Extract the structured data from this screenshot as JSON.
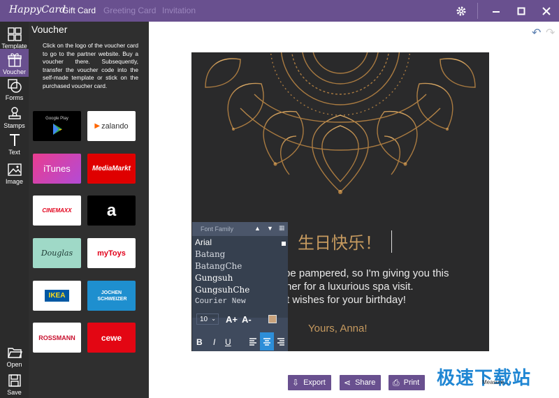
{
  "app": {
    "logo": "HappyCard",
    "tabs": [
      "Gift Card",
      "Greeting Card",
      "Invitation"
    ]
  },
  "rail": {
    "items": [
      {
        "label": "Template",
        "icon": "grid-icon"
      },
      {
        "label": "Voucher",
        "icon": "gift-icon",
        "active": true
      },
      {
        "label": "Forms",
        "icon": "shapes-icon"
      },
      {
        "label": "Stamps",
        "icon": "stamp-icon"
      },
      {
        "label": "Text",
        "icon": "text-icon"
      },
      {
        "label": "Image",
        "icon": "image-icon"
      }
    ],
    "bottom": [
      {
        "label": "Open",
        "icon": "folder-icon"
      },
      {
        "label": "Save",
        "icon": "save-icon"
      }
    ]
  },
  "panel": {
    "title": "Voucher",
    "description": "Click on the logo of the voucher card to go to the partner website. Buy a voucher there. Subsequently, transfer the voucher code into the self-made template or stick on the purchased voucher card.",
    "vouchers": [
      {
        "name": "Google Play",
        "label": "Google Play"
      },
      {
        "name": "zalando",
        "label": "zalando"
      },
      {
        "name": "iTunes",
        "label": "iTunes"
      },
      {
        "name": "MediaMarkt",
        "label": "MediaMarkt"
      },
      {
        "name": "Cinemaxx",
        "label": "CINEMAXX"
      },
      {
        "name": "Amazon",
        "label": "a"
      },
      {
        "name": "Douglas",
        "label": "Douglas"
      },
      {
        "name": "myToys",
        "label": "myToys"
      },
      {
        "name": "IKEA",
        "label": "IKEA"
      },
      {
        "name": "Jochen Schweizer",
        "label": "JOCHEN SCHWEIZER"
      },
      {
        "name": "Rossmann",
        "label": "ROSSMANN"
      },
      {
        "name": "cewe",
        "label": "cewe"
      }
    ]
  },
  "card": {
    "heading": "生日快乐！",
    "body_lines": [
      "be pampered, so I'm giving you this",
      "her for a luxurious spa visit.",
      "t wishes for your birthday!"
    ],
    "signature": "Yours, Anna!"
  },
  "font_toolbar": {
    "header": "Font Family",
    "fonts": [
      "Arial",
      "Batang",
      "BatangChe",
      "Gungsuh",
      "GungsuhChe",
      "Courier New"
    ],
    "size": "10",
    "increase": "A+",
    "decrease": "A-",
    "bold": "B",
    "italic": "I",
    "underline": "U",
    "swatch_color": "#c8a27c"
  },
  "actions": {
    "export": "Export",
    "share": "Share",
    "print": "Print"
  },
  "watermark": {
    "text": "极速下载站",
    "sub": "Measure..."
  },
  "colors": {
    "accent": "#69508f",
    "gold": "#c69a5f"
  }
}
